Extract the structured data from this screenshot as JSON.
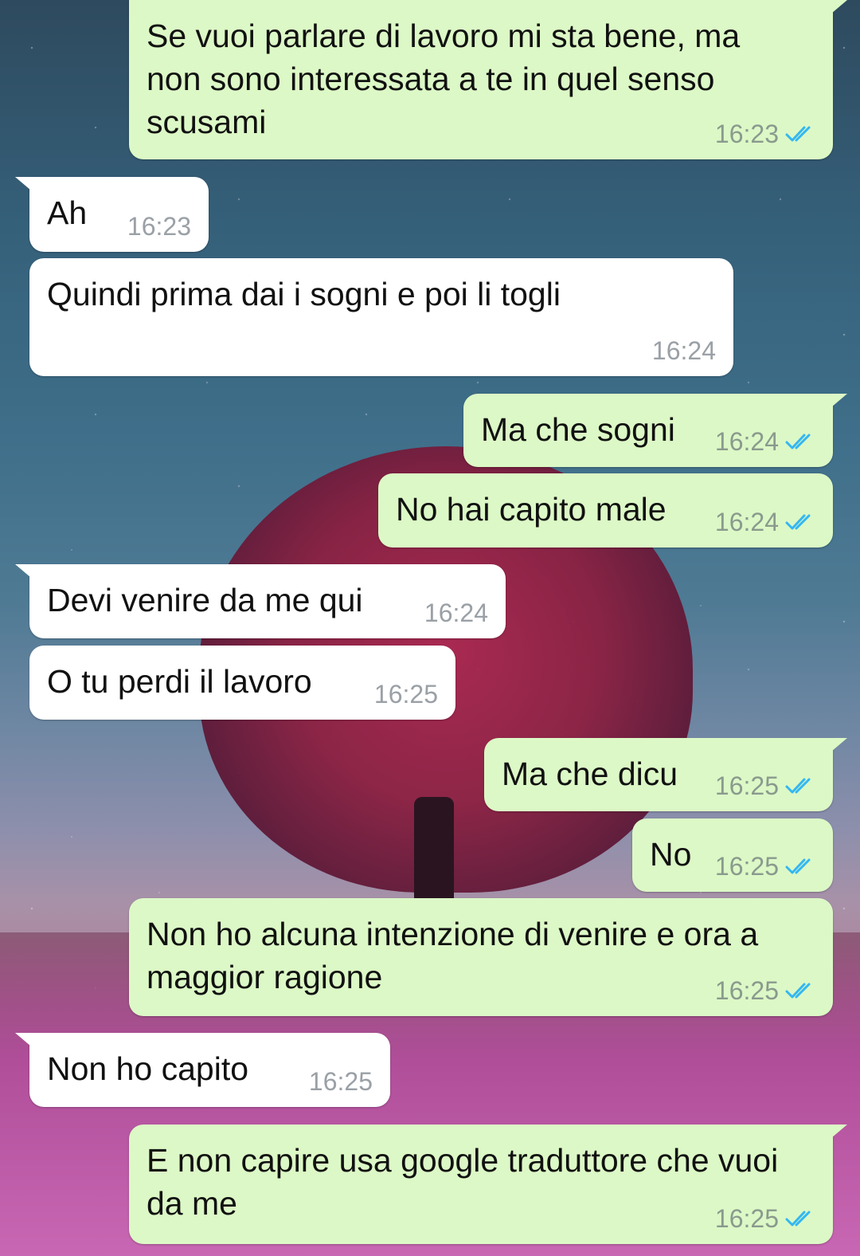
{
  "colors": {
    "outgoing_bubble": "#dcf8c6",
    "incoming_bubble": "#ffffff",
    "read_ticks": "#34b7f1",
    "timestamp": "#8a9a8e"
  },
  "messages": [
    {
      "direction": "outgoing",
      "text": "Se vuoi parlare di lavoro mi sta bene, ma non sono interessata a te in quel senso scusami",
      "time": "16:23",
      "status": "read",
      "icon": "double-check-icon"
    },
    {
      "direction": "incoming",
      "text": "Ah",
      "time": "16:23"
    },
    {
      "direction": "incoming",
      "text": "Quindi prima dai i sogni e poi li togli",
      "time": "16:24"
    },
    {
      "direction": "outgoing",
      "text": "Ma che sogni",
      "time": "16:24",
      "status": "read",
      "icon": "double-check-icon"
    },
    {
      "direction": "outgoing",
      "text": "No hai capito male",
      "time": "16:24",
      "status": "read",
      "icon": "double-check-icon"
    },
    {
      "direction": "incoming",
      "text": "Devi venire da me qui",
      "time": "16:24"
    },
    {
      "direction": "incoming",
      "text": "O tu perdi il lavoro",
      "time": "16:25"
    },
    {
      "direction": "outgoing",
      "text": "Ma che dicu",
      "time": "16:25",
      "status": "read",
      "icon": "double-check-icon"
    },
    {
      "direction": "outgoing",
      "text": "No",
      "time": "16:25",
      "status": "read",
      "icon": "double-check-icon"
    },
    {
      "direction": "outgoing",
      "text": "Non ho alcuna intenzione di venire e ora a maggior ragione",
      "time": "16:25",
      "status": "read",
      "icon": "double-check-icon"
    },
    {
      "direction": "incoming",
      "text": "Non ho capito",
      "time": "16:25"
    },
    {
      "direction": "outgoing",
      "text": "E non capire usa google traduttore che vuoi da me",
      "time": "16:25",
      "status": "read",
      "icon": "double-check-icon"
    }
  ]
}
